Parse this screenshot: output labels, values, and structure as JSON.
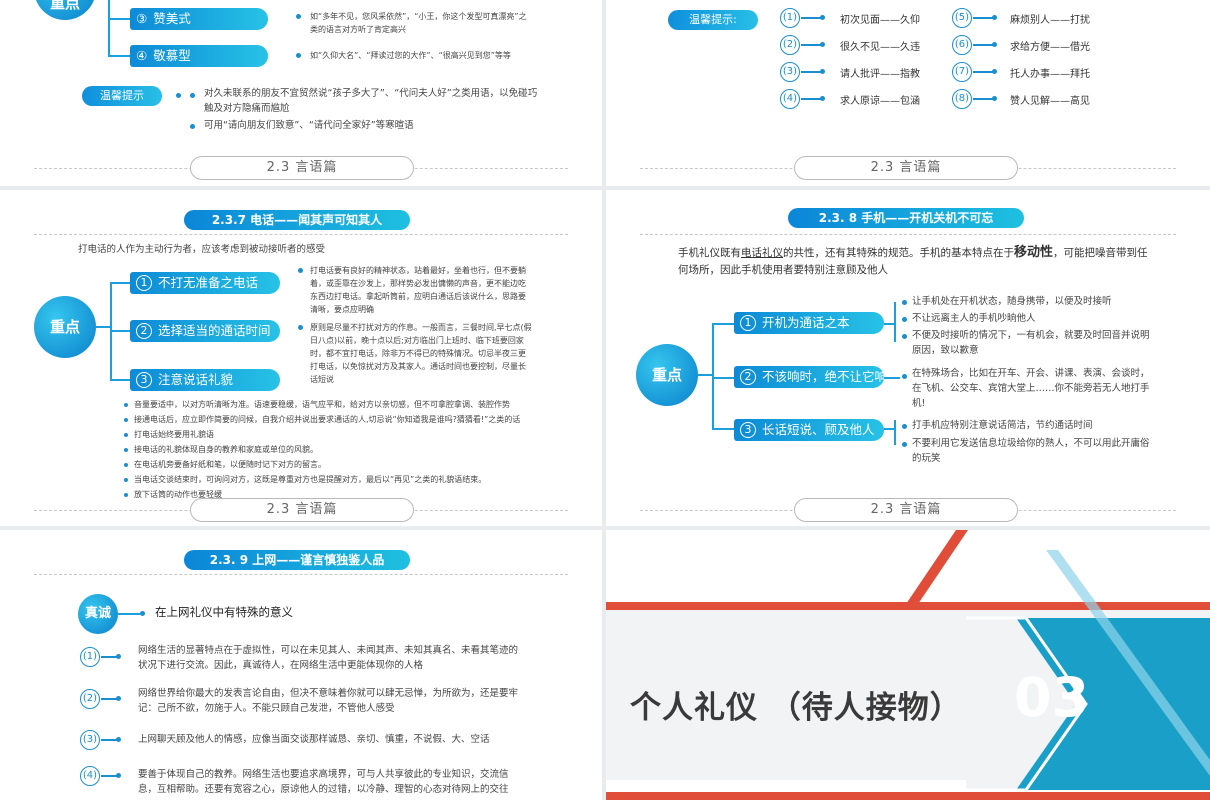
{
  "s1": {
    "focus_label": "重点",
    "pills": [
      {
        "num": "③",
        "label": "赞美式"
      },
      {
        "num": "④",
        "label": "敬慕型"
      }
    ],
    "pill_texts": [
      "如“多年不见，您风采依然”，“小王，你这个发型可真漂亮”之类的语言对方听了肯定高兴",
      "如“久仰大名”、“拜读过您的大作”、“很高兴见到您”等等"
    ],
    "tip_label": "温馨提示",
    "tips": [
      "对久未联系的朋友不宜贸然说“孩子多大了”、“代问夫人好”之类用语，以免碰巧触及对方隐痛而尴尬",
      "可用“请向朋友们致意”、“请代问全家好”等寒暄语"
    ],
    "footer": "2.3  言语篇"
  },
  "s2": {
    "tip_label": "温馨提示:",
    "items": [
      {
        "num": "(1)",
        "text": "初次见面——久仰"
      },
      {
        "num": "(2)",
        "text": "很久不见——久违"
      },
      {
        "num": "(3)",
        "text": "请人批评——指教"
      },
      {
        "num": "(4)",
        "text": "求人原谅——包涵"
      },
      {
        "num": "(5)",
        "text": "麻烦别人——打扰"
      },
      {
        "num": "(6)",
        "text": "求给方便——借光"
      },
      {
        "num": "(7)",
        "text": "托人办事——拜托"
      },
      {
        "num": "(8)",
        "text": "赞人见解——高见"
      }
    ],
    "footer": "2.3  言语篇"
  },
  "s3": {
    "header": "2.3.7  电话——闻其声可知其人",
    "intro": "打电话的人作为主动行为者，应该考虑到被动接听者的感受",
    "focus_label": "重点",
    "pills": [
      {
        "num": "1",
        "label": "不打无准备之电话"
      },
      {
        "num": "2",
        "label": "选择适当的通话时间"
      },
      {
        "num": "3",
        "label": "注意说话礼貌"
      }
    ],
    "right_texts": [
      "打电话要有良好的精神状态，站着最好，坐着也行，但不要躺着，或歪靠在沙发上，那样势必发出慵懒的声音，更不能边吃东西边打电话。拿起听筒前，应明白通话后该说什么，思路要清晰，要点应明确",
      "原则是尽量不打扰对方的作息。一般而言，三餐时间,早七点(假日八点)以前，晚十点以后;对方临出门上班时、临下班要回家时，都不宜打电话，除非万不得已的特殊情况。切忌半夜三更打电话，以免惊扰对方及其家人。通话时间也要控制，尽量长话短说"
    ],
    "bullets": [
      "音量要适中，以对方听清晰为准。语速要稳缓，语气应平和，给对方以亲切感，但不可拿腔拿调、装腔作势",
      "接通电话后，应立即作简要的问候，自我介绍并说出要求通话的人,切忌说“你知道我是谁吗?猜猜看!”之类的话",
      "打电话始终要用礼貌语",
      "接电话的礼貌体现自身的教养和家庭或单位的风貌。",
      "在电话机旁要备好纸和笔，以便随时记下对方的留言。",
      "当电话交谈结束时，可询问对方，这既是尊重对方也是提醒对方，最后以“再见”之类的礼貌语结束。",
      "放下话筒的动作也要轻缓"
    ],
    "footer": "2.3  言语篇"
  },
  "s4": {
    "header": "2.3. 8  手机——开机关机不可忘",
    "intro_a": "手机礼仪既有",
    "intro_u": "电话礼仪",
    "intro_b": "的共性，还有其特殊的规范。手机的基本特点在于",
    "intro_bold": "移动性",
    "intro_c": "，可能把噪音带到任何场所，因此手机使用者要特别注意顾及他人",
    "focus_label": "重点",
    "pills": [
      {
        "num": "1",
        "label": "开机为通话之本"
      },
      {
        "num": "2",
        "label": "不该响时，绝不让它响"
      },
      {
        "num": "3",
        "label": "长话短说、顾及他人"
      }
    ],
    "groups": [
      [
        "让手机处在开机状态，随身携带，以便及时接听",
        "不让远离主人的手机吵晌他人",
        "不便及时接听的情况下，一有机会，就要及时回音并说明原因，致以歉意"
      ],
      [
        "在特殊场合，比如在开车、开会、讲课、表演、会谈时，在飞机、公交车、宾馆大堂上……你不能旁若无人地打手机!"
      ],
      [
        "打手机应特别注意说话简洁，节约通话时间",
        "不要利用它发送信息垃圾给你的熟人，不可以用此开庸俗的玩笑"
      ]
    ],
    "footer": "2.3  言语篇"
  },
  "s5": {
    "header": "2.3. 9  上网——谨言慎独鉴人品",
    "badge": "真诚",
    "subtitle": "在上网礼仪中有特殊的意义",
    "items": [
      {
        "num": "(1)",
        "text": "网络生活的显著特点在于虚拟性，可以在未见其人、未闻其声、未知其真名、未看其笔迹的状况下进行交流。因此，真诚待人，在网络生活中更能体现你的人格"
      },
      {
        "num": "(2)",
        "text": "网络世界给你最大的发表言论自由，但决不意味着你就可以肆无忌惮，为所欲为，还是要牢记：己所不欲，勿施于人。不能只顾自己发泄，不管他人感受"
      },
      {
        "num": "(3)",
        "text": "上网聊天顾及他人的情感，应像当面交谈那样诚恳、亲切、慎重，不说假、大、空话"
      },
      {
        "num": "(4)",
        "text": "要善于体现自己的教养。网络生活也要追求高境界，可与人共享彼此的专业知识，交流信息，互相帮助。还要有宽容之心，原谅他人的过错，以冷静、理智的心态对待网上的交往"
      }
    ]
  },
  "s6": {
    "title": "个人礼仪 （待人接物）",
    "number": "03"
  }
}
